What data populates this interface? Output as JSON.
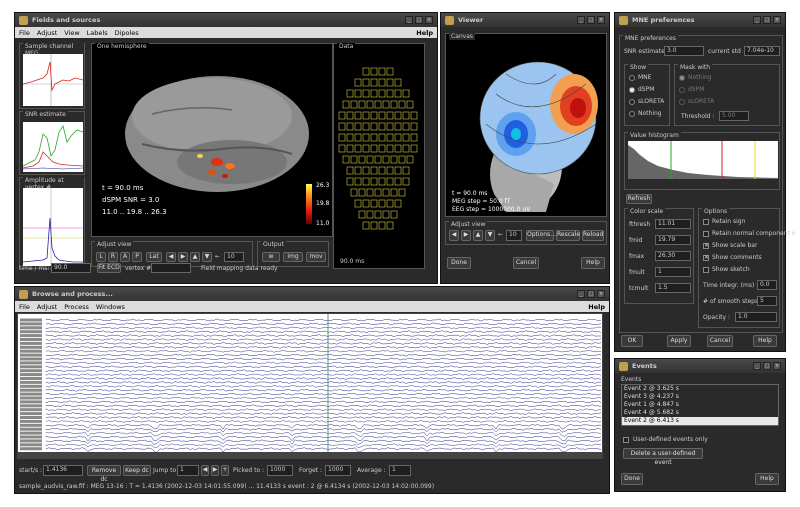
{
  "fields": {
    "title": "Fields and sources",
    "menu": [
      "File",
      "Adjust",
      "View",
      "Labels",
      "Dipoles"
    ],
    "help": "Help",
    "panels": {
      "sample": "Sample channel MEG",
      "snr": "SNR estimate",
      "amp": "Amplitude at vertex #",
      "hemi": "One hemisphere",
      "data": "Data",
      "adjust": "Adjust view",
      "output": "Output"
    },
    "hemi_text": {
      "t": "t = 90.0 ms",
      "dspm": "dSPM   SNR = 3.0",
      "range": "11.0 .. 19.8 .. 26.3"
    },
    "colorbar": {
      "top": "26.3",
      "mid": "19.8",
      "bot": "11.0"
    },
    "data_time": "90.0 ms",
    "adjust_btns": [
      "L",
      "R",
      "A",
      "P"
    ],
    "lat_label": "Lat",
    "step_value": "10",
    "output_btns": [
      "w",
      "img",
      "mov"
    ],
    "time_label": "time / ms:",
    "time_value": "90.0",
    "fit_ecd": "Fit ECD",
    "vertex_label": "vertex #",
    "status": "Field mapping data ready"
  },
  "viewer": {
    "title": "Viewer",
    "canvas_label": "Canvas",
    "info": [
      "t = 90.0 ms",
      "MEG step = 50.0 fT",
      "EEG step = 1000000.0 uV"
    ],
    "adjust_label": "Adjust view",
    "step_value": "10",
    "buttons": [
      "Options...",
      "Rescale",
      "Reload"
    ],
    "done": "Done",
    "cancel": "Cancel",
    "help": "Help"
  },
  "mne": {
    "title": "MNE preferences",
    "section": "MNE preferences",
    "snr_label": "SNR estimate",
    "snr_value": "3.0",
    "current_std_label": "current std",
    "current_std_value": "7.04e-10",
    "show_label": "Show",
    "show_opts": [
      "MNE",
      "dSPM",
      "sLORETA",
      "Nothing"
    ],
    "mask_label": "Mask with",
    "mask_opts": [
      "Nothing",
      "dSPM",
      "sLORETA"
    ],
    "threshold_label": "Threshold :",
    "threshold_value": "5.00",
    "hist_label": "Value histogram",
    "hist_ticks": [
      "11.0",
      "19.8",
      "26.3"
    ],
    "refresh": "Refresh",
    "color_scale": "Color scale",
    "scale_rows": [
      {
        "label": "fthresh",
        "value": "11.01"
      },
      {
        "label": "fmid",
        "value": "19.79"
      },
      {
        "label": "fmax",
        "value": "26.30"
      },
      {
        "label": "fmult",
        "value": "1"
      },
      {
        "label": "tcmult",
        "value": "1.5"
      }
    ],
    "options_label": "Options",
    "options": [
      {
        "label": "Retain sign",
        "on": false
      },
      {
        "label": "Retain normal component o",
        "on": false
      },
      {
        "label": "Show scale bar",
        "on": true
      },
      {
        "label": "Show comments",
        "on": true
      },
      {
        "label": "Show sketch",
        "on": false
      }
    ],
    "time_integr_label": "Time integr. (ms) :",
    "time_integr_value": "0.0",
    "smooth_label": "# of smooth steps :",
    "smooth_value": "5",
    "opacity_label": "Opacity :",
    "opacity_value": "1.0",
    "ok": "OK",
    "apply": "Apply",
    "cancel": "Cancel",
    "help": "Help"
  },
  "events": {
    "title": "Events",
    "label": "Events",
    "items": [
      "Event 2 @ 3.625 s",
      "Event 3 @ 4.237 s",
      "Event 1 @ 4.847 s",
      "Event 4 @ 5.682 s",
      "Event 2 @ 6.413 s"
    ],
    "user_only": "User-defined events only",
    "delete_btn": "Delete a user-defined event",
    "done": "Done",
    "help": "Help"
  },
  "browse": {
    "title": "Browse and process...",
    "menu": [
      "File",
      "Adjust",
      "Process",
      "Windows"
    ],
    "help": "Help",
    "start_label": "start/s :",
    "start_value": "1.4136",
    "remove_dc": "Remove dc",
    "keep_dc": "Keep dc",
    "jump_label": "Jump to :",
    "jump_value": "1",
    "picked_label": "Picked to :",
    "picked_value": "1000",
    "forget_label": "Forget :",
    "forget_value": "1000",
    "average_label": "Average :",
    "average_value": "1",
    "status": "sample_audvis_raw.fif : MEG 13-16 : T = 1.4136 (2002-12-03 14:01:55.099) ... 11.4133 s    event : 2 @ 6.4134 s (2002-12-03 14:02:00.099)"
  }
}
